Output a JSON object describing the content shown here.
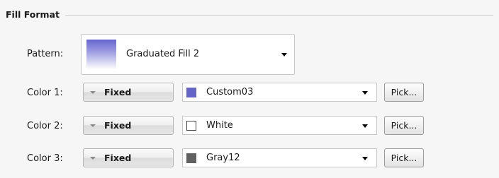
{
  "group": {
    "title": "Fill Format"
  },
  "pattern": {
    "label": "Pattern:",
    "value": "Graduated Fill 2",
    "gradient_colors": [
      "#6565d0",
      "#ffffff"
    ]
  },
  "colors": [
    {
      "label": "Color 1:",
      "mode": "Fixed",
      "name": "Custom03",
      "swatch": "#6565c8",
      "pick": "Pick..."
    },
    {
      "label": "Color 2:",
      "mode": "Fixed",
      "name": "White",
      "swatch": "#ffffff",
      "pick": "Pick..."
    },
    {
      "label": "Color 3:",
      "mode": "Fixed",
      "name": "Gray12",
      "swatch": "#606060",
      "pick": "Pick..."
    }
  ],
  "icons": {
    "dropdown": "chevron-down-icon",
    "mode_dropdown": "caret-down-icon"
  }
}
